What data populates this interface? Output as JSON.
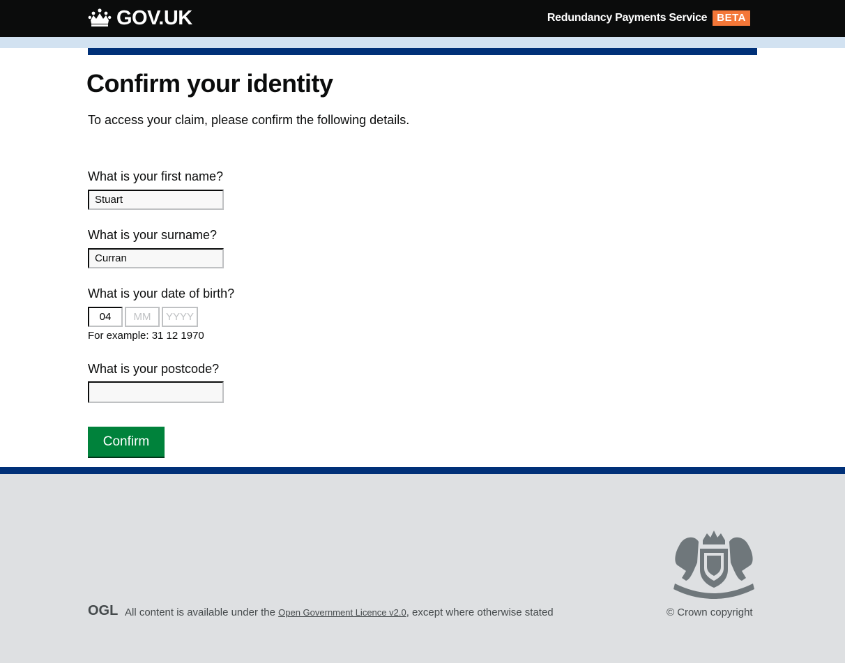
{
  "header": {
    "logo_text": "GOV.UK",
    "service_name": "Redundancy Payments Service",
    "phase_tag": "BETA"
  },
  "main": {
    "title": "Confirm your identity",
    "lead": "To access your claim, please confirm the following details.",
    "fields": {
      "first_name": {
        "label": "What is your first name?",
        "value": "Stuart"
      },
      "surname": {
        "label": "What is your surname?",
        "value": "Curran"
      },
      "dob": {
        "label": "What is your date of birth?",
        "day_value": "04",
        "month_placeholder": "MM",
        "year_placeholder": "YYYY",
        "hint": "For example: 31 12 1970"
      },
      "postcode": {
        "label": "What is your postcode?",
        "value": ""
      }
    },
    "submit_label": "Confirm"
  },
  "footer": {
    "ogl_logo": "OGL",
    "licence_prefix": "All content is available under the ",
    "licence_link": "Open Government Licence v2.0",
    "licence_suffix": ", except where otherwise stated",
    "copyright": "© Crown copyright"
  },
  "colors": {
    "header_bg": "#0b0c0c",
    "beta_tag": "#f47738",
    "accent_blue": "#003078",
    "button_green": "#00823b",
    "footer_bg": "#dee0e2"
  }
}
